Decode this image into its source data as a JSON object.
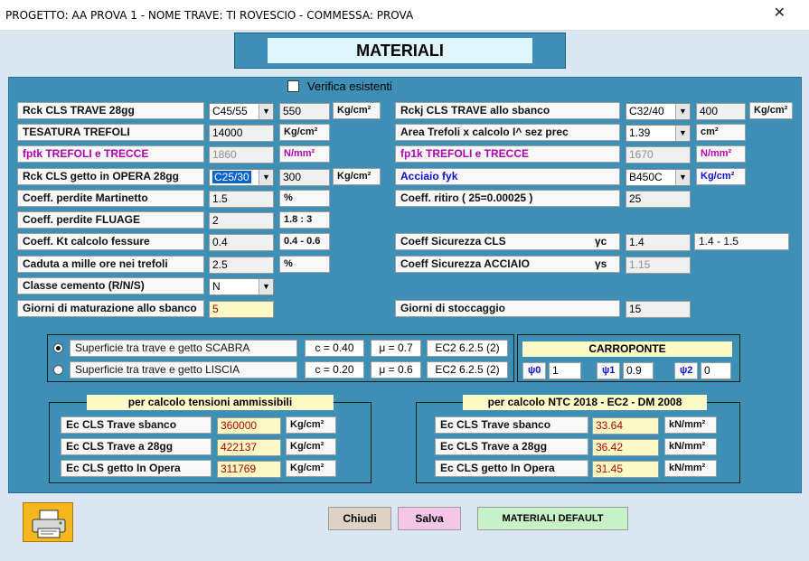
{
  "window": {
    "title": "PROGETTO: AA PROVA 1 - NOME TRAVE: TI ROVESCIO - COMMESSA: PROVA",
    "close_glyph": "✕"
  },
  "header": {
    "title": "MATERIALI"
  },
  "verifica": {
    "label": "Verifica esistenti",
    "checked": false
  },
  "left": {
    "rck_trave": {
      "label": "Rck CLS TRAVE 28gg",
      "combo": "C45/55",
      "value": "550",
      "unit": "Kg/cm²"
    },
    "tesatura": {
      "label": "TESATURA TREFOLI",
      "value": "14000",
      "unit": "Kg/cm²"
    },
    "fptk": {
      "label": "fptk TREFOLI  e  TRECCE",
      "value": "1860",
      "unit": "N/mm²"
    },
    "rck_getto": {
      "label": "Rck CLS getto in OPERA 28gg",
      "combo": "C25/30",
      "value": "300",
      "unit": "Kg/cm²"
    },
    "perdite_mart": {
      "label": "Coeff. perdite Martinetto",
      "value": "1.5",
      "unit": "%"
    },
    "perdite_fluage": {
      "label": "Coeff. perdite FLUAGE",
      "value": "2",
      "unit": "1.8  :  3"
    },
    "kt": {
      "label": "Coeff. Kt calcolo fessure",
      "value": "0.4",
      "unit": "0.4 - 0.6"
    },
    "caduta": {
      "label": "Caduta a mille ore nei trefoli",
      "value": "2.5",
      "unit": "%"
    },
    "classe": {
      "label": "Classe cemento (R/N/S)",
      "combo": "N"
    },
    "giorni_mat": {
      "label": "Giorni di maturazione allo sbanco",
      "value": "5"
    }
  },
  "right": {
    "rckj": {
      "label": "Rckj CLS TRAVE allo sbanco",
      "combo": "C32/40",
      "value": "400",
      "unit": "Kg/cm²"
    },
    "area": {
      "label": "Area Trefoli x calcolo I^ sez prec",
      "combo": "1.39",
      "unit": "cm²"
    },
    "fp1k": {
      "label": "fp1k TREFOLI  e  TRECCE",
      "value": "1670",
      "unit": "N/mm²"
    },
    "acciaio": {
      "label": "Acciaio fyk",
      "combo": "B450C",
      "unit": "Kg/cm²"
    },
    "ritiro": {
      "label": "Coeff. ritiro ( 25=0.00025 )",
      "value": "25"
    },
    "sic_cls": {
      "label": "Coeff Sicurezza CLS",
      "symbol": "γc",
      "value": "1.4",
      "unit": "1.4 - 1.5"
    },
    "sic_acc": {
      "label": "Coeff Sicurezza ACCIAIO",
      "symbol": "γs",
      "value": "1.15"
    },
    "stoccaggio": {
      "label": "Giorni di stoccaggio",
      "value": "15"
    }
  },
  "superficie": {
    "scabra": {
      "label": "Superficie tra trave e getto  SCABRA",
      "c": "c = 0.40",
      "mu": "μ = 0.7",
      "ref": "EC2 6.2.5 (2)",
      "selected": true
    },
    "liscia": {
      "label": "Superficie tra trave e getto  LISCIA",
      "c": "c = 0.20",
      "mu": "μ = 0.6",
      "ref": "EC2 6.2.5 (2)",
      "selected": false
    }
  },
  "carroponte": {
    "title": "CARROPONTE",
    "psi0": {
      "label": "ψ0",
      "value": "1"
    },
    "psi1": {
      "label": "ψ1",
      "value": "0.9"
    },
    "psi2": {
      "label": "ψ2",
      "value": "0"
    }
  },
  "tensioni": {
    "title": "per calcolo tensioni ammissibili",
    "rows": [
      {
        "label": "Ec CLS Trave sbanco",
        "value": "360000",
        "unit": "Kg/cm²"
      },
      {
        "label": "Ec CLS Trave a 28gg",
        "value": "422137",
        "unit": "Kg/cm²"
      },
      {
        "label": "Ec CLS getto In Opera",
        "value": "311769",
        "unit": "Kg/cm²"
      }
    ]
  },
  "ntc": {
    "title": "per calcolo NTC 2018 - EC2 - DM 2008",
    "rows": [
      {
        "label": "Ec CLS Trave sbanco",
        "value": "33.64",
        "unit": "kN/mm²"
      },
      {
        "label": "Ec CLS Trave a 28gg",
        "value": "36.42",
        "unit": "kN/mm²"
      },
      {
        "label": "Ec CLS getto In Opera",
        "value": "31.45",
        "unit": "kN/mm²"
      }
    ]
  },
  "buttons": {
    "print_icon": "printer-icon",
    "chiudi": "Chiudi",
    "salva": "Salva",
    "default": "MATERIALI DEFAULT"
  },
  "colors": {
    "panel": "#3d8fb6",
    "header_bg": "#dff7fc",
    "highlight": "#fdfbc5",
    "chiudi": "#ddd2c3",
    "salva": "#f4c6e8",
    "default": "#c7f2c8"
  }
}
